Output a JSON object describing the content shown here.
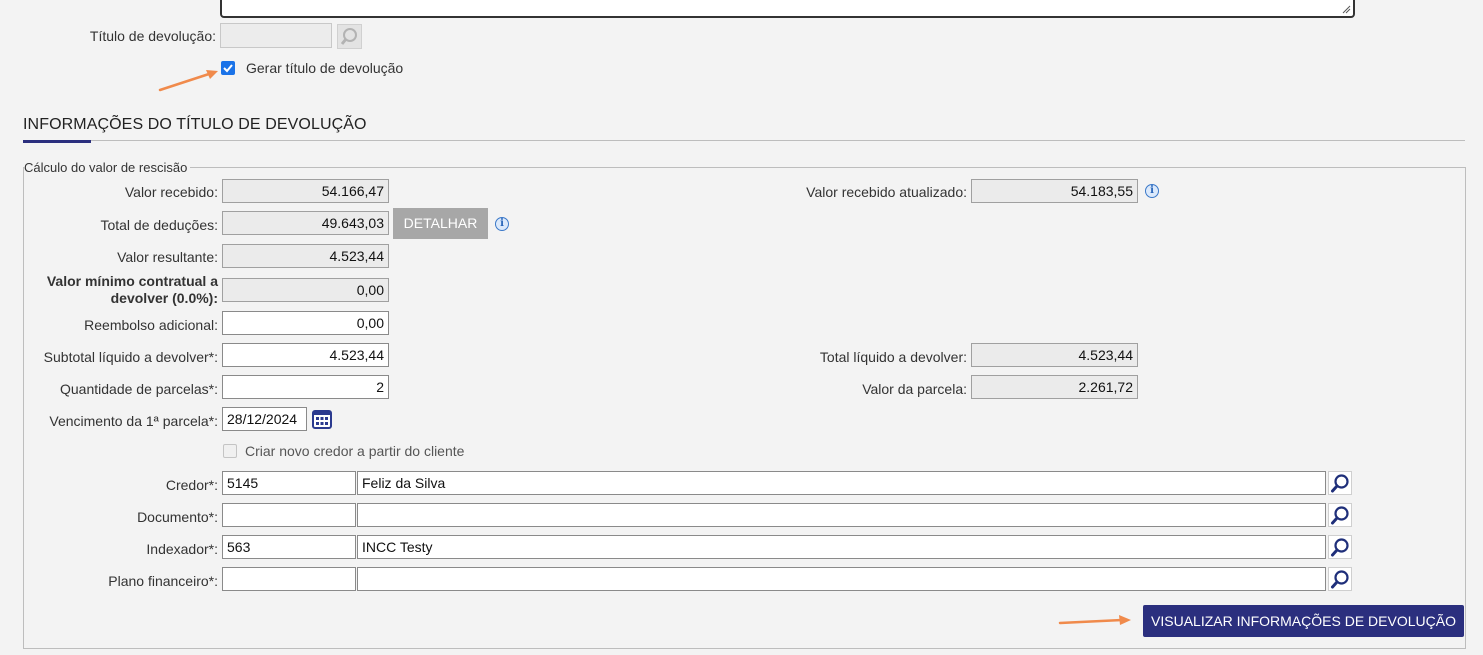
{
  "top": {
    "titulo_label": "Título de devolução:",
    "gerar_label": "Gerar título de devolução",
    "gerar_checked": true
  },
  "section": {
    "title": "INFORMAÇÕES DO TÍTULO DE DEVOLUÇÃO",
    "fieldset_legend": "Cálculo do valor de rescisão"
  },
  "fields": {
    "valor_recebido_label": "Valor recebido:",
    "valor_recebido": "54.166,47",
    "valor_recebido_atualizado_label": "Valor recebido atualizado:",
    "valor_recebido_atualizado": "54.183,55",
    "total_deducoes_label": "Total de deduções:",
    "total_deducoes": "49.643,03",
    "detalhar_button": "DETALHAR",
    "valor_resultante_label": "Valor resultante:",
    "valor_resultante": "4.523,44",
    "valor_minimo_label_1": "Valor mínimo contratual a",
    "valor_minimo_label_2": "devolver (0.0%):",
    "valor_minimo": "0,00",
    "reembolso_label": "Reembolso adicional:",
    "reembolso": "0,00",
    "subtotal_label": "Subtotal líquido a devolver*:",
    "subtotal": "4.523,44",
    "total_liquido_label": "Total líquido a devolver:",
    "total_liquido": "4.523,44",
    "qtd_parcelas_label": "Quantidade de parcelas*:",
    "qtd_parcelas": "2",
    "valor_parcela_label": "Valor da parcela:",
    "valor_parcela": "2.261,72",
    "vencimento_label": "Vencimento da 1ª parcela*:",
    "vencimento": "28/12/2024",
    "criar_credor_label": "Criar novo credor a partir do cliente",
    "criar_credor_checked": false,
    "credor_label": "Credor*:",
    "credor_code": "5145",
    "credor_name": "Feliz da Silva",
    "documento_label": "Documento*:",
    "documento_code": "",
    "documento_name": "",
    "indexador_label": "Indexador*:",
    "indexador_code": "563",
    "indexador_name": "INCC Testy",
    "plano_label": "Plano financeiro*:",
    "plano_code": "",
    "plano_name": ""
  },
  "actions": {
    "visualizar_button": "VISUALIZAR INFORMAÇÕES DE DEVOLUÇÃO"
  },
  "colors": {
    "primary_button": "#2b2f7e",
    "accent_underline": "#2b2f7e",
    "annotation_arrow": "#f08a4b",
    "detalhar_bg": "#a7a7a7"
  },
  "icons": {
    "info": "info-icon",
    "search": "magnifier-icon",
    "calendar": "calendar-icon",
    "arrow": "annotation-arrow"
  }
}
